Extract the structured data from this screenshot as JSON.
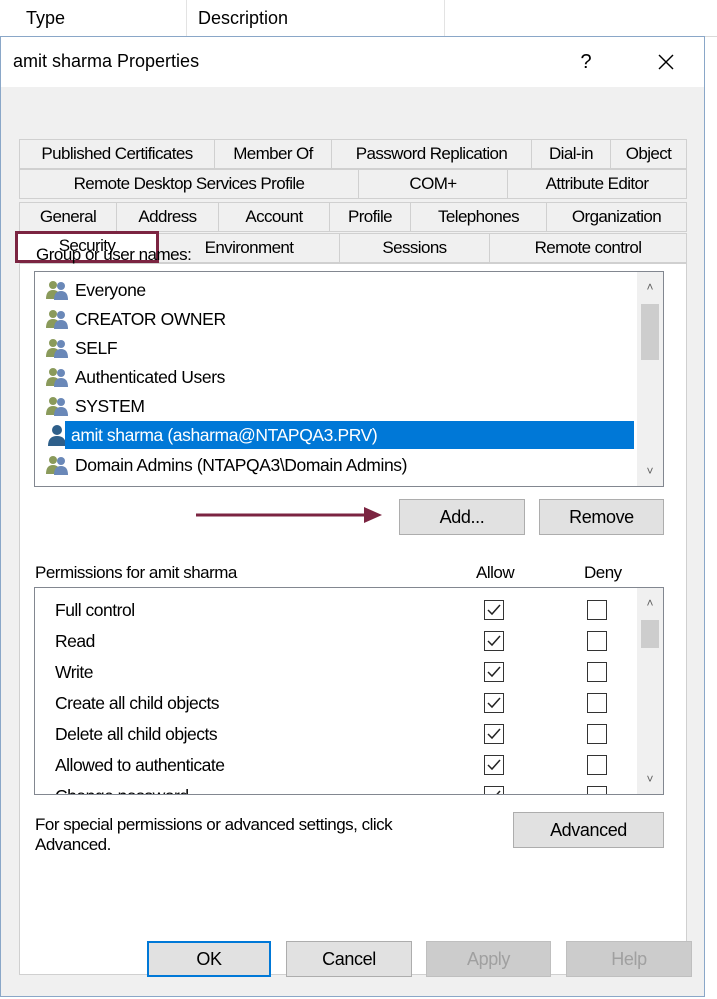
{
  "background_list": {
    "col_type": "Type",
    "col_description": "Description"
  },
  "dialog": {
    "title": "amit sharma Properties",
    "help_label": "?"
  },
  "tabs": {
    "row1": [
      "Published Certificates",
      "Member Of",
      "Password Replication",
      "Dial-in",
      "Object"
    ],
    "row2": [
      "Remote Desktop Services Profile",
      "COM+",
      "Attribute Editor"
    ],
    "row3": [
      "General",
      "Address",
      "Account",
      "Profile",
      "Telephones",
      "Organization"
    ],
    "row4": [
      "Security",
      "Environment",
      "Sessions",
      "Remote control"
    ],
    "active": "Security"
  },
  "security": {
    "group_label": "Group or user names:",
    "users": [
      {
        "name": "Everyone",
        "icon": "group-icon"
      },
      {
        "name": "CREATOR OWNER",
        "icon": "group-icon"
      },
      {
        "name": "SELF",
        "icon": "group-icon"
      },
      {
        "name": "Authenticated Users",
        "icon": "group-icon"
      },
      {
        "name": "SYSTEM",
        "icon": "group-icon"
      },
      {
        "name": "amit sharma (asharma@NTAPQA3.PRV)",
        "icon": "user-icon",
        "selected": true
      },
      {
        "name": "Domain Admins (NTAPQA3\\Domain Admins)",
        "icon": "group-icon"
      }
    ],
    "add_label": "Add...",
    "remove_label": "Remove",
    "permissions_label": "Permissions for amit sharma",
    "allow_header": "Allow",
    "deny_header": "Deny",
    "permissions": [
      {
        "name": "Full control",
        "allow": true,
        "deny": false
      },
      {
        "name": "Read",
        "allow": true,
        "deny": false
      },
      {
        "name": "Write",
        "allow": true,
        "deny": false
      },
      {
        "name": "Create all child objects",
        "allow": true,
        "deny": false
      },
      {
        "name": "Delete all child objects",
        "allow": true,
        "deny": false
      },
      {
        "name": "Allowed to authenticate",
        "allow": true,
        "deny": false
      },
      {
        "name": "Change password",
        "allow": true,
        "deny": false
      }
    ],
    "special_text_line1": "For special permissions or advanced settings, click",
    "special_text_line2": "Advanced.",
    "advanced_label": "Advanced"
  },
  "footer": {
    "ok_label": "OK",
    "cancel_label": "Cancel",
    "apply_label": "Apply",
    "help_label": "Help"
  },
  "colors": {
    "selection": "#0078d7",
    "highlight_border": "#7b2441",
    "annotation_arrow": "#7b2441"
  }
}
